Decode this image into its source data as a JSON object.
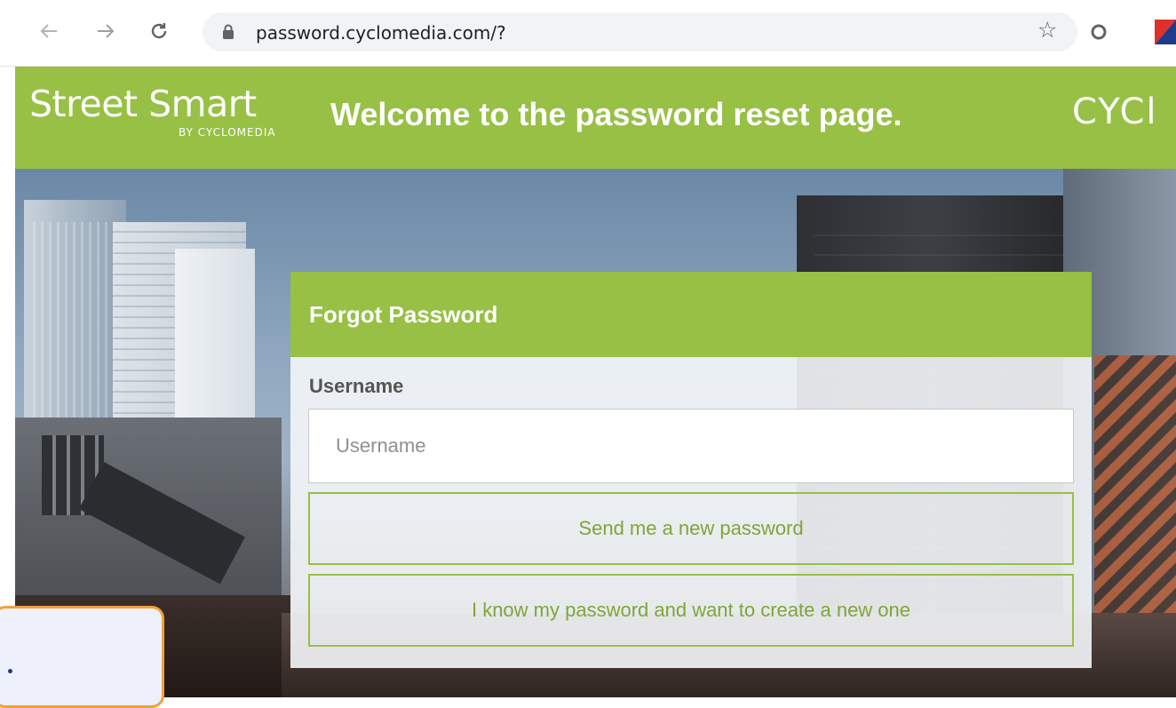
{
  "browser": {
    "url": "password.cyclomedia.com/?",
    "back_icon": "arrow-left-icon",
    "forward_icon": "arrow-right-icon",
    "reload_icon": "reload-icon"
  },
  "header": {
    "logo_word1": "Street",
    "logo_word2": "Smart",
    "logo_sub": "BY CYCLOMEDIA",
    "welcome": "Welcome to the password reset page.",
    "brand_cut": "CYCl",
    "color": "#97c045"
  },
  "card": {
    "title": "Forgot Password",
    "username_label": "Username",
    "username_placeholder": "Username",
    "username_value": "",
    "send_button": "Send me a new password",
    "create_button": "I know my password and want to create a new one"
  },
  "colors": {
    "accent": "#97c045",
    "overlay_border": "#f2a03c"
  }
}
